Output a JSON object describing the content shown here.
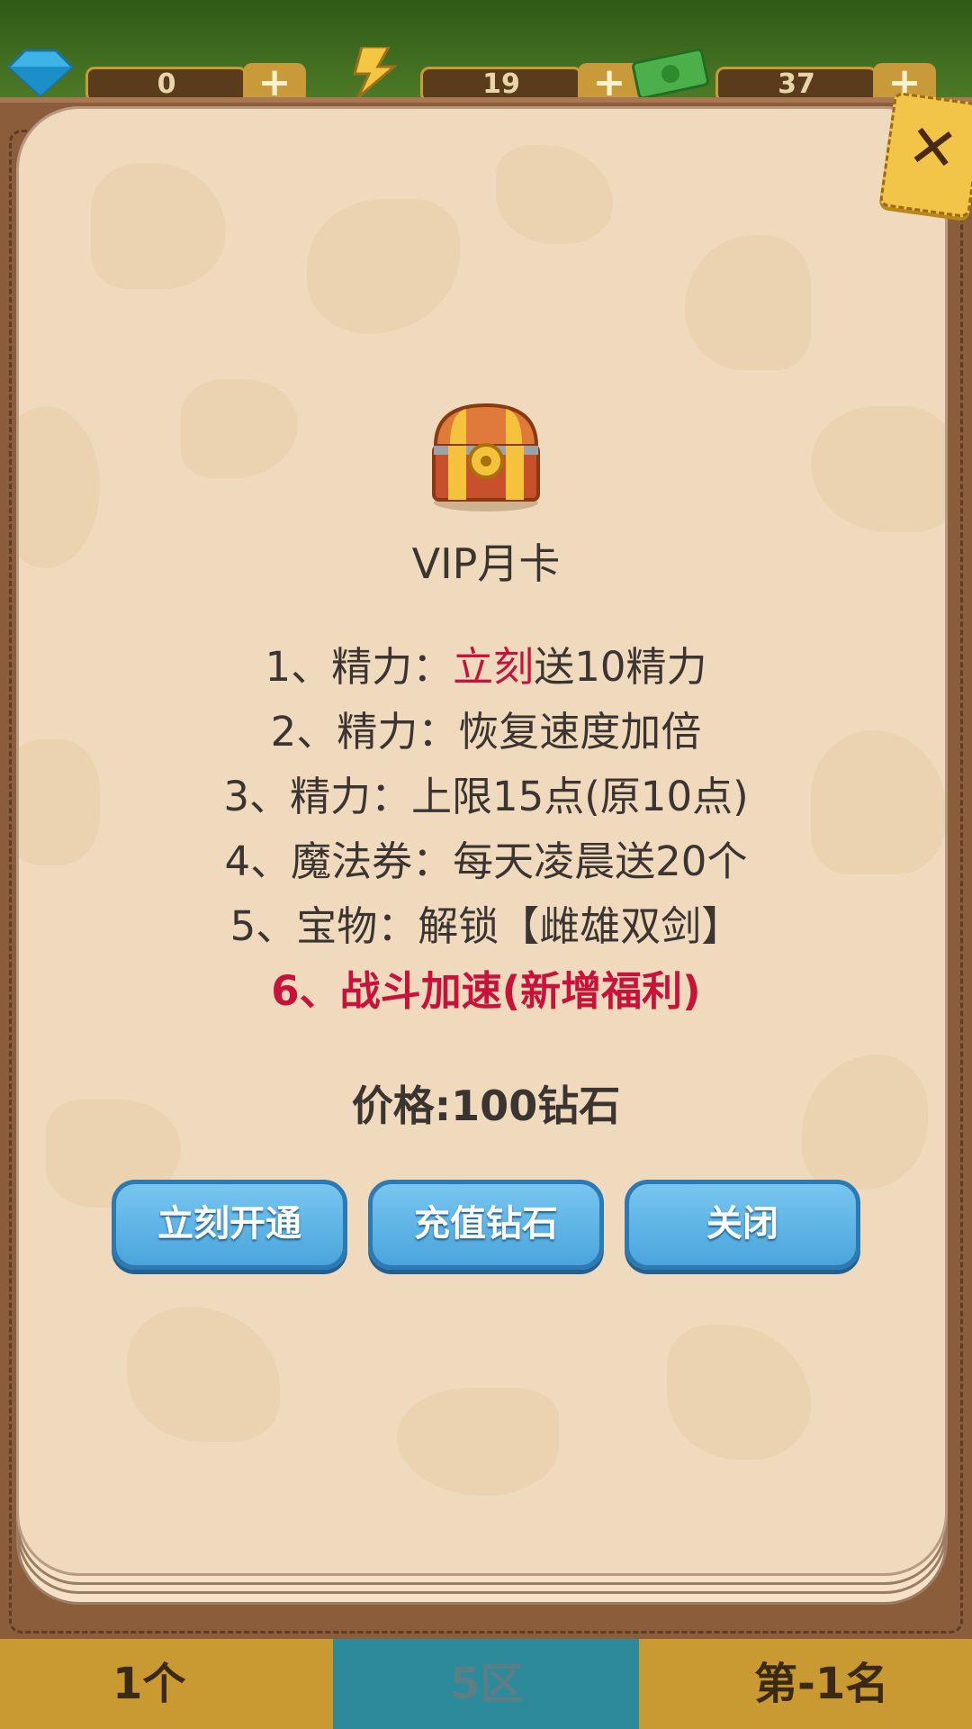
{
  "topbar": {
    "gems": {
      "icon": "gem-icon",
      "value": "0"
    },
    "energy": {
      "icon": "lightning-icon",
      "value": "19"
    },
    "cash": {
      "icon": "money-icon",
      "value": "37"
    },
    "plus_label": "+"
  },
  "dialog": {
    "close_label": "✕",
    "chest_icon": "treasure-chest-icon",
    "title": "VIP月卡",
    "benefits": [
      {
        "prefix": "1、精力：",
        "highlight": "立刻",
        "suffix": "送10精力"
      },
      {
        "text": "2、精力：恢复速度加倍"
      },
      {
        "text": "3、精力：上限15点(原10点)"
      },
      {
        "text": "4、魔法券：每天凌晨送20个"
      },
      {
        "text": "5、宝物：解锁【雌雄双剑】"
      },
      {
        "text": "6、战斗加速(新增福利)"
      }
    ],
    "price": "价格:100钻石",
    "buttons": {
      "activate": "立刻开通",
      "recharge": "充值钻石",
      "close": "关闭"
    }
  },
  "bottom_bar": {
    "count": "1个",
    "zone": "5区",
    "rank": "第-1名"
  },
  "colors": {
    "accent_red": "#c8123a",
    "button_blue": "#4aa4dc",
    "paper": "#f0dabd",
    "frame_brown": "#8b5d3b"
  }
}
